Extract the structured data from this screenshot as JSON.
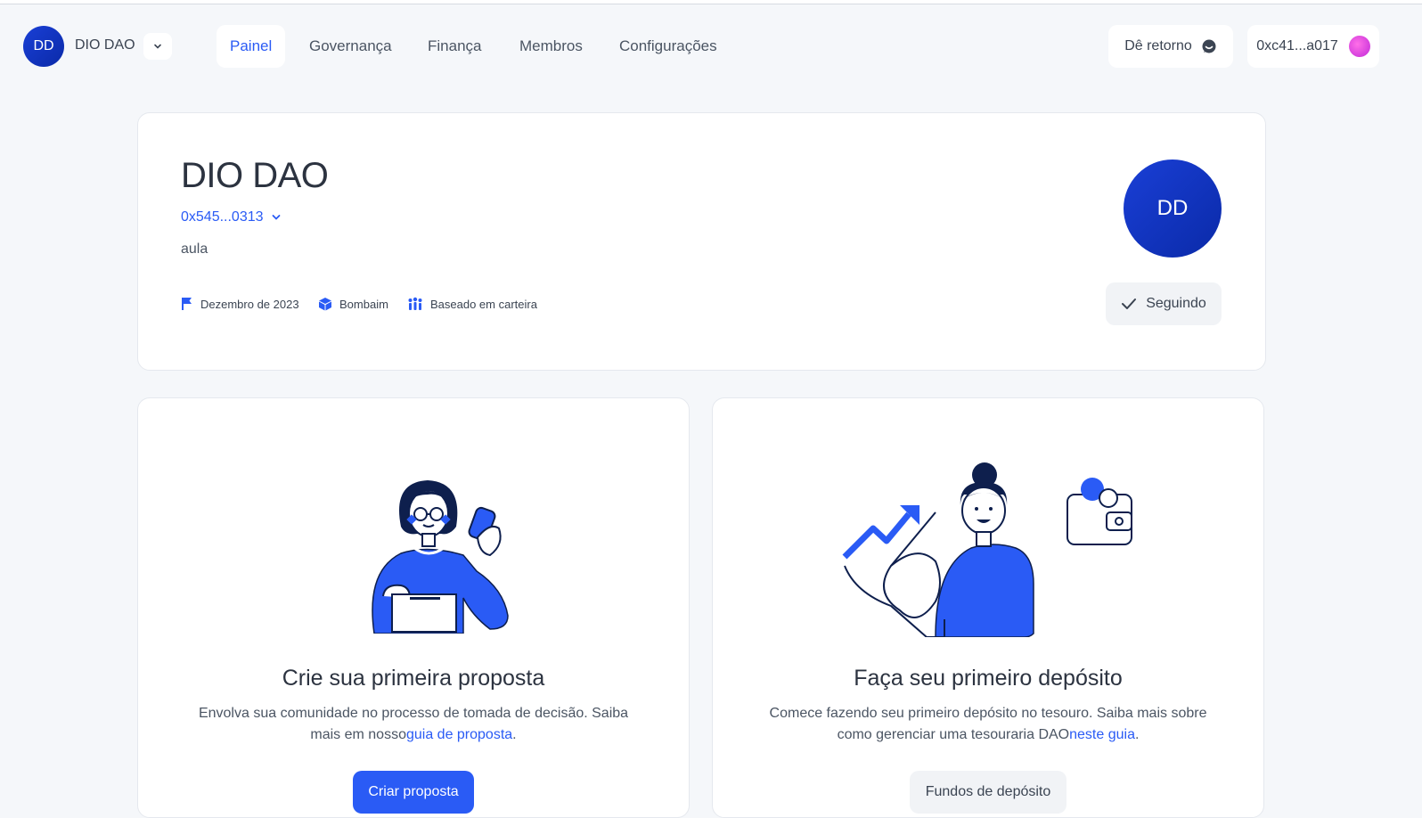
{
  "header": {
    "dao_initials": "DD",
    "dao_name": "DIO DAO",
    "tabs": [
      {
        "label": "Painel",
        "active": true
      },
      {
        "label": "Governança",
        "active": false
      },
      {
        "label": "Finança",
        "active": false
      },
      {
        "label": "Membros",
        "active": false
      },
      {
        "label": "Configurações",
        "active": false
      }
    ],
    "feedback_label": "Dê retorno",
    "wallet_address": "0xc41...a017"
  },
  "hero": {
    "title": "DIO DAO",
    "address": "0x545...0313",
    "description": "aula",
    "meta": [
      {
        "icon": "flag-icon",
        "label": "Dezembro de 2023"
      },
      {
        "icon": "cube-icon",
        "label": "Bombaim"
      },
      {
        "icon": "people-icon",
        "label": "Baseado em carteira"
      }
    ],
    "avatar_initials": "DD",
    "follow_label": "Seguindo"
  },
  "proposal": {
    "title": "Crie sua primeira proposta",
    "text": "Envolva sua comunidade no processo de tomada de decisão. Saiba mais em nosso",
    "link": "guia de proposta",
    "text_end": ".",
    "button": "Criar proposta"
  },
  "deposit": {
    "title": "Faça seu primeiro depósito",
    "text": "Comece fazendo seu primeiro depósito no tesouro. Saiba mais sobre como gerenciar uma tesouraria DAO",
    "link": "neste guia",
    "text_end": ".",
    "button": "Fundos de depósito"
  },
  "colors": {
    "accent": "#2a5bf5",
    "avatar": "#1a3fd6",
    "background": "#f5f7fa"
  }
}
